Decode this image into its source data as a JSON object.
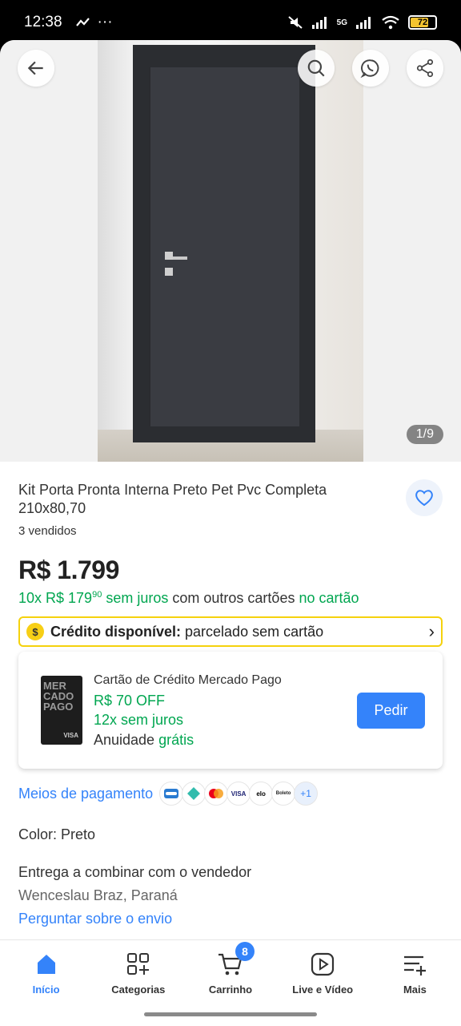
{
  "status_bar": {
    "time": "12:38",
    "battery": "72",
    "network": "5G"
  },
  "gallery": {
    "counter": "1/9"
  },
  "product": {
    "title": "Kit Porta Pronta Interna Preto Pet Pvc Completa 210x80,70",
    "sold": "3 vendidos",
    "price": "R$ 1.799",
    "installments": {
      "count": "10x R$ 179",
      "cents": "90",
      "no_interest": "sem juros",
      "other_cards": "com outros cartões",
      "on_card": "no cartão"
    }
  },
  "credit": {
    "coin_symbol": "$",
    "label": "Crédito disponível:",
    "text": "parcelado sem cartão"
  },
  "mp_card": {
    "card_text": "MER CADO PAGO",
    "card_brand": "VISA",
    "title": "Cartão de Crédito Mercado Pago",
    "off": "R$ 70 OFF",
    "installments": "12x sem juros",
    "annuity": "Anuidade",
    "annuity_free": "grátis",
    "button": "Pedir"
  },
  "payment": {
    "label": "Meios de pagamento",
    "icons": [
      "amex-icon",
      "pix-icon",
      "mastercard-icon",
      "visa-icon",
      "elo-icon",
      "boleto-icon"
    ],
    "icon_texts": [
      "",
      "",
      "",
      "VISA",
      "elo",
      "Boleto"
    ],
    "more": "+1"
  },
  "color": {
    "label": "Color:",
    "value": "Preto"
  },
  "delivery": {
    "text": "Entrega a combinar com o vendedor",
    "location": "Wenceslau Braz, Paraná",
    "ask": "Perguntar sobre o envio"
  },
  "nav": {
    "items": [
      {
        "label": "Início",
        "icon": "home-icon"
      },
      {
        "label": "Categorias",
        "icon": "categories-icon"
      },
      {
        "label": "Carrinho",
        "icon": "cart-icon",
        "badge": "8"
      },
      {
        "label": "Live e Vídeo",
        "icon": "play-icon"
      },
      {
        "label": "Mais",
        "icon": "more-icon"
      }
    ]
  },
  "colors": {
    "brand_blue": "#3483fa",
    "green": "#00a650",
    "yellow": "#f5d20d"
  }
}
